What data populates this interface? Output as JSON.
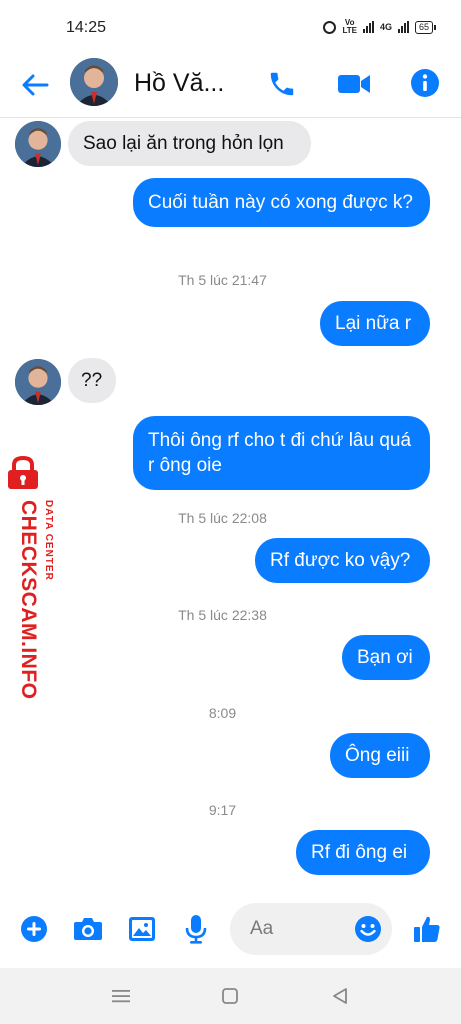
{
  "status_bar": {
    "time": "14:25",
    "volte_label": "Vo\nLTE",
    "network_label": "4G",
    "battery": "65"
  },
  "header": {
    "contact_name": "Hồ Vă...",
    "back_icon": "arrow-left-icon",
    "call_icon": "phone-icon",
    "video_icon": "video-camera-icon",
    "info_icon": "info-icon"
  },
  "messages": [
    {
      "direction": "in",
      "text": "Sao lại ăn trong hỏn lọn"
    },
    {
      "direction": "out",
      "text": "Cuối tuần này có xong được k?"
    },
    {
      "type": "timestamp",
      "text": "Th 5 lúc 21:47"
    },
    {
      "direction": "out",
      "text": "Lại nữa r"
    },
    {
      "direction": "in",
      "text": "??"
    },
    {
      "direction": "out",
      "text": "Thôi ông rf cho t đi chứ lâu quá r ông oie"
    },
    {
      "type": "timestamp",
      "text": "Th 5 lúc 22:08"
    },
    {
      "direction": "out",
      "text": "Rf được ko vậy?"
    },
    {
      "type": "timestamp",
      "text": "Th 5 lúc 22:38"
    },
    {
      "direction": "out",
      "text": "Bạn ơi"
    },
    {
      "type": "timestamp",
      "text": "8:09"
    },
    {
      "direction": "out",
      "text": "Ông eiii"
    },
    {
      "type": "timestamp",
      "text": "9:17"
    },
    {
      "direction": "out",
      "text": "Rf đi ông ei"
    }
  ],
  "watermark": {
    "main": "CHECKSCAM.INFO",
    "sub": "DATA CENTER"
  },
  "composer": {
    "placeholder": "Aa",
    "icons": [
      "plus-circle-icon",
      "camera-icon",
      "image-icon",
      "microphone-icon",
      "emoji-icon",
      "thumbs-up-icon"
    ]
  },
  "navbar": {
    "icons": [
      "menu-icon",
      "home-square-icon",
      "back-triangle-icon"
    ]
  },
  "colors": {
    "accent": "#0a7cff",
    "incoming_bubble": "#e9e9eb",
    "timestamp": "#8a8a8a",
    "watermark": "#e02020"
  }
}
